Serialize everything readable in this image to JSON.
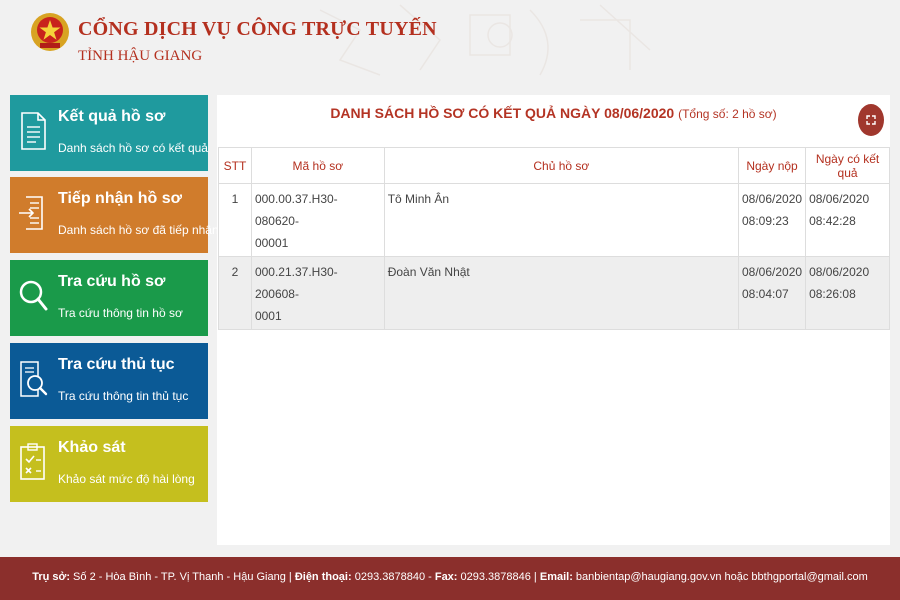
{
  "header": {
    "title": "CỔNG DỊCH VỤ CÔNG TRỰC TUYẾN",
    "subtitle": "TỈNH HẬU GIANG",
    "emblem_icon": "national-emblem-icon"
  },
  "menu": [
    {
      "title": "Kết quả hồ sơ",
      "desc": "Danh sách hồ sơ có kết quả",
      "color": "#1f9a9e",
      "icon": "document-icon"
    },
    {
      "title": "Tiếp nhận hồ sơ",
      "desc": "Danh sách hồ sơ đã tiếp nhận",
      "color": "#d07c2c",
      "icon": "document-import-icon"
    },
    {
      "title": "Tra cứu hồ sơ",
      "desc": "Tra cứu thông tin hồ sơ",
      "color": "#1a9a4a",
      "icon": "search-icon"
    },
    {
      "title": "Tra cứu thủ tục",
      "desc": "Tra cứu thông tin thủ tục",
      "color": "#0b5a96",
      "icon": "document-search-icon"
    },
    {
      "title": "Khảo sát",
      "desc": "Khảo sát mức độ hài lòng",
      "color": "#c5bf1e",
      "icon": "clipboard-check-icon"
    }
  ],
  "panel": {
    "title": "DANH SÁCH HỒ SƠ CÓ KẾT QUẢ NGÀY 08/06/2020",
    "count": "(Tổng số: 2 hồ sơ)",
    "expand_icon": "fullscreen-icon"
  },
  "table": {
    "headers": [
      "STT",
      "Mã hồ sơ",
      "Chủ hồ sơ",
      "Ngày nộp",
      "Ngày có kết quả"
    ],
    "rows": [
      {
        "stt": "1",
        "ma_l1": "000.00.37.H30-080620-",
        "ma_l2": "00001",
        "chu": "Tô Minh Ân",
        "nop_date": "08/06/2020",
        "nop_time": "08:09:23",
        "kq_date": "08/06/2020",
        "kq_time": "08:42:28"
      },
      {
        "stt": "2",
        "ma_l1": "000.21.37.H30-200608-",
        "ma_l2": "0001",
        "chu": "Đoàn Văn Nhật",
        "nop_date": "08/06/2020",
        "nop_time": "08:04:07",
        "kq_date": "08/06/2020",
        "kq_time": "08:26:08"
      }
    ]
  },
  "footer": {
    "tru_so_label": "Trụ sở:",
    "tru_so": " Số 2 - Hòa Bình - TP. Vị Thanh - Hậu Giang | ",
    "dien_thoai_label": "Điện thoại:",
    "dien_thoai": " 0293.3878840 - ",
    "fax_label": "Fax:",
    "fax": " 0293.3878846 | ",
    "email_label": "Email:",
    "email": " banbientap@haugiang.gov.vn hoặc bbthgportal@gmail.com"
  },
  "colors": {
    "brand_red": "#b4301f",
    "footer_bg": "#8b2f2c",
    "expand_btn": "#a0372d"
  }
}
